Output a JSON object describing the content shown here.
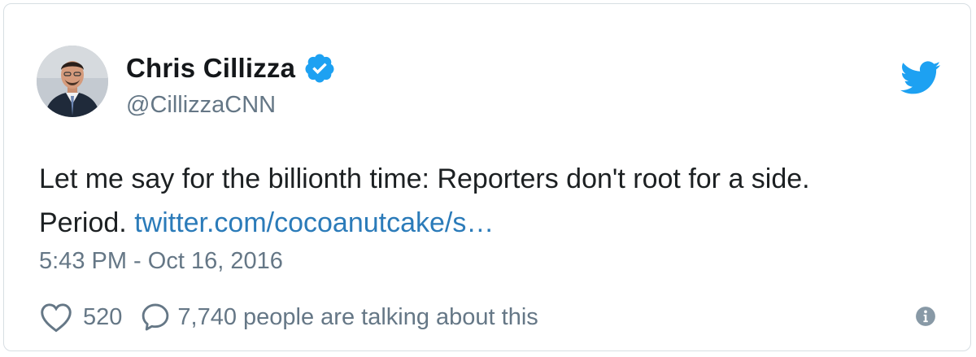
{
  "tweet": {
    "author": {
      "display_name": "Chris Cillizza",
      "handle": "@CillizzaCNN",
      "verified": true,
      "avatar_icon": "person-photo-icon"
    },
    "text_line_1": "Let me say for the billionth time: Reporters don't root for a side.",
    "text_line_2_prefix": "Period.",
    "link_text": "twitter.com/cocoanutcake/s…",
    "timestamp": "5:43 PM - Oct 16, 2016",
    "likes": "520",
    "talking": "7,740 people are talking about this"
  },
  "icons": {
    "brand": "twitter-bird-icon",
    "verified": "verified-badge-icon",
    "like": "heart-icon",
    "reply": "speech-bubble-icon",
    "info": "info-icon"
  },
  "colors": {
    "brand_blue": "#1da1f2",
    "link_blue": "#2b7bb9",
    "text": "#1c2022",
    "muted": "#657786",
    "border": "#d7dee3"
  }
}
